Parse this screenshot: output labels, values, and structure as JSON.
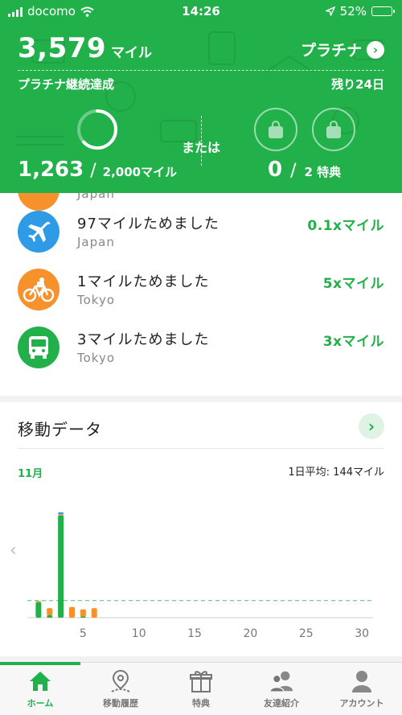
{
  "status_bar": {
    "carrier": "docomo",
    "time": "14:26",
    "battery": "52%",
    "battery_level": 0.52
  },
  "summary": {
    "miles": "3,579",
    "miles_unit": "マイル",
    "tier": "プラチナ",
    "tier_status": "プラチナ継続達成",
    "remaining": "残り24日",
    "progress_current": "1,263",
    "progress_slash": "/",
    "progress_goal": "2,000マイル",
    "progress_fraction": 0.63,
    "or_label": "または",
    "reward_count": "0",
    "reward_slash": "/",
    "reward_total": "2 特典"
  },
  "activities": {
    "partial_subtitle": "Japan",
    "items": [
      {
        "title": "97マイルためました",
        "subtitle": "Japan",
        "multiplier": "0.1xマイル",
        "icon": "airplane-icon",
        "color": "#2f9be6"
      },
      {
        "title": "1マイルためました",
        "subtitle": "Tokyo",
        "multiplier": "5xマイル",
        "icon": "bicycle-icon",
        "color": "#f7912b"
      },
      {
        "title": "3マイルためました",
        "subtitle": "Tokyo",
        "multiplier": "3xマイル",
        "icon": "bus-icon",
        "color": "#22b04b"
      }
    ]
  },
  "movement": {
    "title": "移動データ",
    "month": "11月",
    "daily_average": "1日平均: 144マイル"
  },
  "chart_data": {
    "type": "bar",
    "title": "",
    "xlabel": "",
    "ylabel": "",
    "x_ticks": [
      5,
      10,
      15,
      20,
      25,
      30
    ],
    "xlim": [
      0,
      31
    ],
    "ylim": [
      0,
      1000
    ],
    "average_line": 144,
    "series": [
      {
        "color": "#22b04b",
        "values": [
          {
            "day": 1,
            "value": 130
          },
          {
            "day": 2,
            "value": 20
          },
          {
            "day": 3,
            "value": 860
          },
          {
            "day": 5,
            "value": 10
          }
        ]
      },
      {
        "color": "#f7912b",
        "values": [
          {
            "day": 1,
            "value": 10
          },
          {
            "day": 2,
            "value": 60
          },
          {
            "day": 3,
            "value": 10
          },
          {
            "day": 4,
            "value": 90
          },
          {
            "day": 5,
            "value": 60
          },
          {
            "day": 6,
            "value": 80
          }
        ]
      },
      {
        "color": "#2f9be6",
        "values": [
          {
            "day": 3,
            "value": 15
          }
        ]
      }
    ]
  },
  "tabs": [
    {
      "label": "ホーム",
      "icon": "home-icon",
      "active": true
    },
    {
      "label": "移動履歴",
      "icon": "map-pin-icon",
      "active": false
    },
    {
      "label": "特典",
      "icon": "gift-icon",
      "active": false
    },
    {
      "label": "友達紹介",
      "icon": "friends-icon",
      "active": false
    },
    {
      "label": "アカウント",
      "icon": "account-icon",
      "active": false
    }
  ]
}
